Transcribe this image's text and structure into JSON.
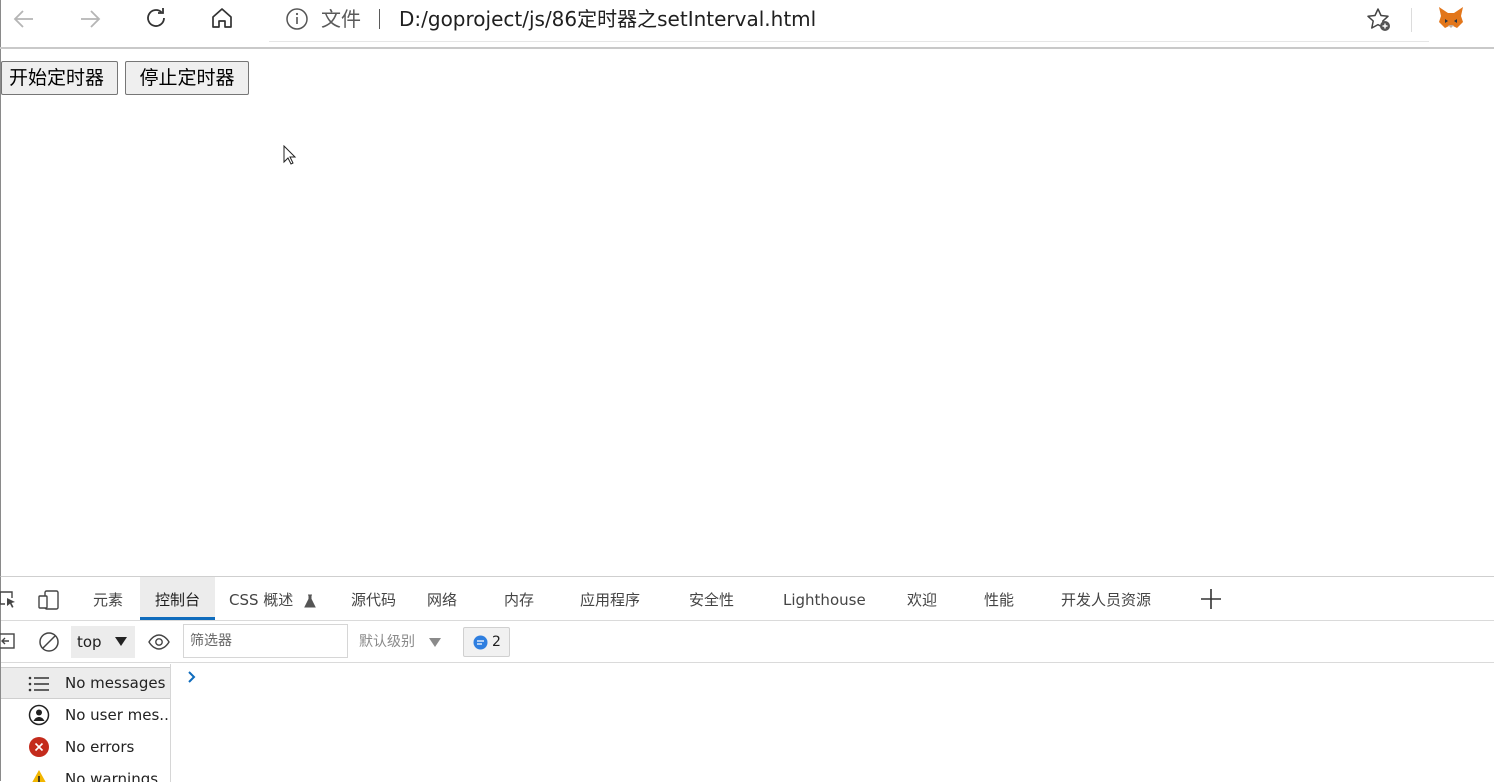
{
  "browser": {
    "address_prefix": "文件",
    "url": "D:/goproject/js/86定时器之setInterval.html"
  },
  "page": {
    "start_button": "开始定时器",
    "stop_button": "停止定时器"
  },
  "devtools": {
    "tabs": [
      {
        "label": "元素"
      },
      {
        "label": "控制台"
      },
      {
        "label": "CSS 概述"
      },
      {
        "label": "源代码"
      },
      {
        "label": "网络"
      },
      {
        "label": "内存"
      },
      {
        "label": "应用程序"
      },
      {
        "label": "安全性"
      },
      {
        "label": "Lighthouse"
      },
      {
        "label": "欢迎"
      },
      {
        "label": "性能"
      },
      {
        "label": "开发人员资源"
      }
    ],
    "console": {
      "context": "top",
      "filter_placeholder": "筛选器",
      "level": "默认级别",
      "message_count": "2"
    },
    "sidebar": [
      {
        "label": "No messages"
      },
      {
        "label": "No user mes..."
      },
      {
        "label": "No errors"
      },
      {
        "label": "No warnings"
      }
    ]
  },
  "colors": {
    "accent": "#0f6cbd",
    "error": "#c42b1c",
    "warning": "#f2b600",
    "prompt": "#0f6cbd"
  }
}
